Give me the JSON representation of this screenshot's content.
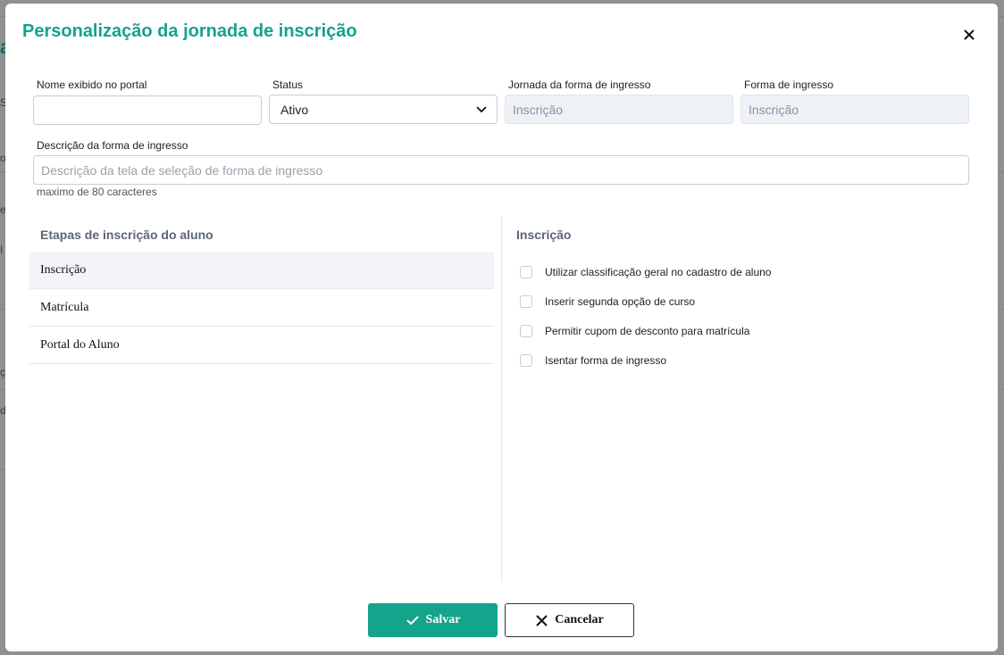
{
  "background": {
    "fragments": [
      "a",
      "S",
      "o",
      "es",
      "I",
      "ç",
      "d"
    ]
  },
  "modal": {
    "title": "Personalização da jornada de inscrição",
    "close_icon": "close-icon"
  },
  "form": {
    "display_name": {
      "label": "Nome exibido no portal",
      "value": ""
    },
    "status": {
      "label": "Status",
      "selected": "Ativo"
    },
    "journey": {
      "label": "Jornada da forma de ingresso",
      "value": "Inscrição"
    },
    "entry_form": {
      "label": "Forma de ingresso",
      "value": "Inscrição"
    },
    "description": {
      "label": "Descrição da forma de ingresso",
      "placeholder": "Descrição da tela de seleção de forma de ingresso",
      "helper": "maximo de 80 caracteres"
    }
  },
  "steps": {
    "title": "Etapas de inscrição do aluno",
    "items": [
      {
        "label": "Inscrição",
        "active": true
      },
      {
        "label": "Matrícula",
        "active": false
      },
      {
        "label": "Portal do Aluno",
        "active": false
      }
    ]
  },
  "options": {
    "title": "Inscrição",
    "items": [
      {
        "label": "Utilizar classificação geral no cadastro de aluno",
        "checked": false
      },
      {
        "label": "Inserir segunda opção de curso",
        "checked": false
      },
      {
        "label": "Permitir cupom de desconto para matrícula",
        "checked": false
      },
      {
        "label": "Isentar forma de ingresso",
        "checked": false
      }
    ]
  },
  "actions": {
    "save_label": "Salvar",
    "cancel_label": "Cancelar"
  },
  "colors": {
    "accent": "#14a38b",
    "overlay": "#8e9093"
  }
}
